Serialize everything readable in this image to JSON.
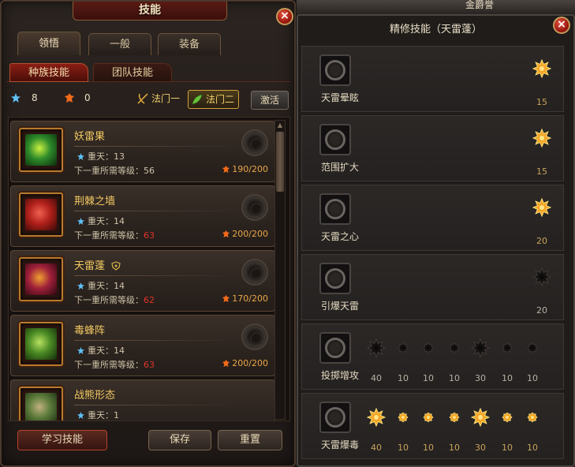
{
  "window": {
    "title": "技能"
  },
  "tabs": [
    {
      "label": "领悟",
      "active": true
    },
    {
      "label": "一般",
      "active": false
    },
    {
      "label": "装备",
      "active": false
    }
  ],
  "subtabs": [
    {
      "label": "种族技能",
      "active": true
    },
    {
      "label": "团队技能",
      "active": false
    }
  ],
  "stats": {
    "blue_points": "8",
    "fire_points": "0"
  },
  "schools": [
    {
      "label": "法门一",
      "active": false
    },
    {
      "label": "法门二",
      "active": true
    }
  ],
  "activate_label": "激活",
  "skills": [
    {
      "name": "妖雷果",
      "level_label": "重天：13",
      "req_label": "下一重所需等级：",
      "req_value": "56",
      "req_red": false,
      "exp": "190/200",
      "icon_color": "#2e8a2a",
      "badge": false
    },
    {
      "name": "荆棘之墙",
      "level_label": "重天：14",
      "req_label": "下一重所需等级：",
      "req_value": "63",
      "req_red": true,
      "exp": "200/200",
      "icon_color": "#b0201a",
      "badge": false
    },
    {
      "name": "天雷蓬",
      "level_label": "重天：14",
      "req_label": "下一重所需等级：",
      "req_value": "62",
      "req_red": true,
      "exp": "170/200",
      "icon_color": "#a0203a",
      "badge": true
    },
    {
      "name": "毒蜂阵",
      "level_label": "重天：14",
      "req_label": "下一重所需等级：",
      "req_value": "63",
      "req_red": true,
      "exp": "200/200",
      "icon_color": "#4a8a24",
      "badge": false
    },
    {
      "name": "战熊形态",
      "level_label": "重天：1",
      "req_label": "",
      "req_value": "",
      "req_red": false,
      "exp": "",
      "icon_color": "#5a7a3a",
      "badge": false
    }
  ],
  "buttons": {
    "learn": "学习技能",
    "save": "保存",
    "reset": "重置"
  },
  "right": {
    "top_text": "金爵誉",
    "title": "精修技能（天雷蓬）",
    "rows": [
      {
        "name": "天雷晕眩",
        "stars": [
          {
            "value": "15",
            "lit": true,
            "big": true
          }
        ]
      },
      {
        "name": "范围扩大",
        "stars": [
          {
            "value": "15",
            "lit": true,
            "big": true
          }
        ]
      },
      {
        "name": "天雷之心",
        "stars": [
          {
            "value": "20",
            "lit": true,
            "big": true
          }
        ]
      },
      {
        "name": "引爆天雷",
        "stars": [
          {
            "value": "20",
            "lit": false,
            "big": true
          }
        ]
      },
      {
        "name": "投掷增攻",
        "stars": [
          {
            "value": "40",
            "lit": false,
            "big": true
          },
          {
            "value": "10",
            "lit": false,
            "big": false
          },
          {
            "value": "10",
            "lit": false,
            "big": false
          },
          {
            "value": "10",
            "lit": false,
            "big": false
          },
          {
            "value": "30",
            "lit": false,
            "big": true
          },
          {
            "value": "10",
            "lit": false,
            "big": false
          },
          {
            "value": "10",
            "lit": false,
            "big": false
          }
        ]
      },
      {
        "name": "天雷爆毒",
        "stars": [
          {
            "value": "40",
            "lit": true,
            "big": true
          },
          {
            "value": "10",
            "lit": true,
            "big": false
          },
          {
            "value": "10",
            "lit": true,
            "big": false
          },
          {
            "value": "10",
            "lit": true,
            "big": false
          },
          {
            "value": "30",
            "lit": true,
            "big": true
          },
          {
            "value": "10",
            "lit": true,
            "big": false
          },
          {
            "value": "10",
            "lit": true,
            "big": false
          }
        ]
      }
    ]
  },
  "colors": {
    "accent_gold": "#f2c962",
    "danger_red": "#e0342a",
    "star_lit": "#f3a526",
    "star_dim": "#2a2826"
  }
}
